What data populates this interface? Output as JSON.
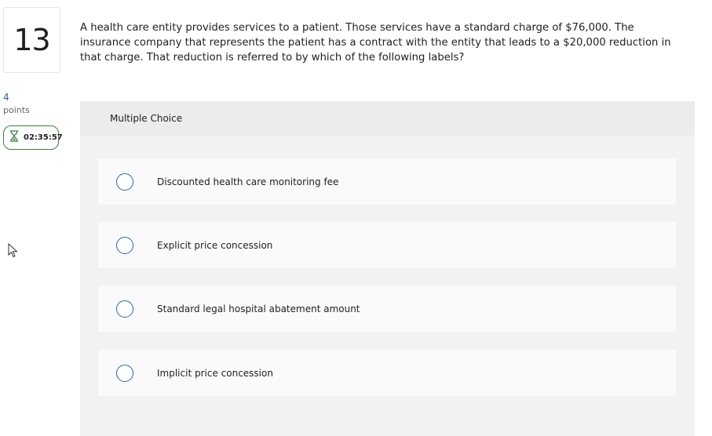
{
  "question_number": "13",
  "points": {
    "value": "4",
    "label": "points"
  },
  "timer": {
    "icon": "hourglass-icon",
    "text": "02:35:57",
    "border_color": "#3c7d3c"
  },
  "question_text": "A health care entity provides services to a patient. Those services have a standard charge of $76,000. The insurance company that represents the patient has a contract with the entity that leads to a $20,000 reduction in that charge. That reduction is referred to by which of the following labels?",
  "answer_panel": {
    "header": "Multiple Choice",
    "options": [
      {
        "label": "Discounted health care monitoring fee",
        "selected": false
      },
      {
        "label": "Explicit price concession",
        "selected": false
      },
      {
        "label": "Standard legal hospital abatement amount",
        "selected": false
      },
      {
        "label": "Implicit price concession",
        "selected": false
      }
    ]
  },
  "colors": {
    "accent": "#2b62ae",
    "points": "#2a5da8"
  }
}
